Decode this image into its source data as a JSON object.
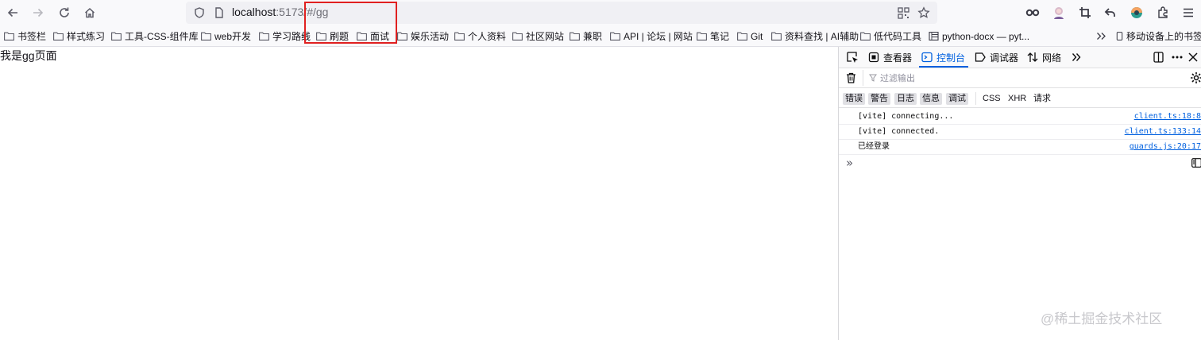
{
  "browser": {
    "url_host": "localhost",
    "url_rest": ":5173/#/gg"
  },
  "bookmarks": [
    {
      "label": "书签栏"
    },
    {
      "label": "样式练习"
    },
    {
      "label": "工具-CSS-组件库"
    },
    {
      "label": "web开发"
    },
    {
      "label": "学习路线"
    },
    {
      "label": "刷题"
    },
    {
      "label": "面试"
    },
    {
      "label": "娱乐活动"
    },
    {
      "label": "个人资料"
    },
    {
      "label": "社区网站"
    },
    {
      "label": "兼职"
    },
    {
      "label": "API | 论坛 | 网站"
    },
    {
      "label": "笔记"
    },
    {
      "label": "Git"
    },
    {
      "label": "资料查找 | AI辅助"
    },
    {
      "label": "低代码工具"
    },
    {
      "label": "python-docx — pyt..."
    }
  ],
  "mobile_bookmarks": "移动设备上的书签",
  "page": {
    "text": "我是gg页面"
  },
  "devtools": {
    "tabs": {
      "inspector": "查看器",
      "console": "控制台",
      "debugger": "调试器",
      "network": "网络"
    },
    "filter_placeholder": "过滤输出",
    "categories": {
      "errors": "错误",
      "warnings": "警告",
      "logs": "日志",
      "info": "信息",
      "debug": "调试",
      "css": "CSS",
      "xhr": "XHR",
      "requests": "请求"
    },
    "logs": [
      {
        "message": "[vite] connecting...",
        "source": "client.ts:18:8"
      },
      {
        "message": "[vite] connected.",
        "source": "client.ts:133:14"
      },
      {
        "message": "已经登录",
        "source": "guards.js:20:17"
      }
    ],
    "prompt": "»"
  },
  "watermark": "@稀土掘金技术社区",
  "colors": {
    "accent": "#0060df",
    "highlight_box": "#e02020"
  }
}
